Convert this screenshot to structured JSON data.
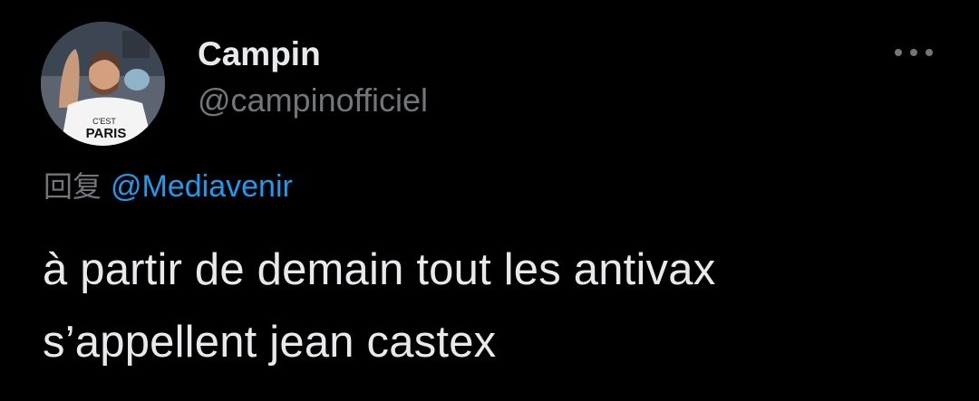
{
  "user": {
    "display_name": "Campin",
    "handle": "@campinofficiel",
    "avatar_icon": "profile-photo"
  },
  "more_icon": "more-horizontal-icon",
  "reply": {
    "prefix": "回复",
    "mention": "@Mediavenir"
  },
  "tweet": {
    "lines": [
      "à partir de demain tout les antivax",
      "s’appellent jean castex"
    ]
  },
  "colors": {
    "background": "#000000",
    "primary_text": "#e7e9ea",
    "secondary_text": "#71767b",
    "link": "#1d9bf0"
  }
}
